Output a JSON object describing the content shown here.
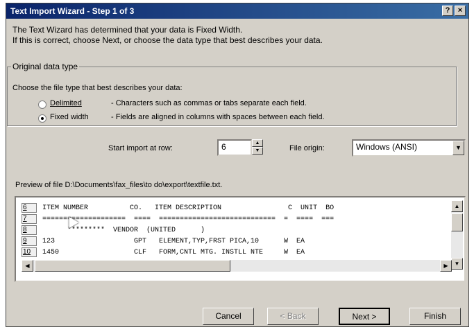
{
  "window": {
    "title": "Text Import Wizard - Step 1 of 3",
    "help_label": "?",
    "close_label": "×"
  },
  "intro": {
    "line1": "The Text Wizard has determined that your data is Fixed Width.",
    "line2": "If this is correct, choose Next, or choose the data type that best describes your data."
  },
  "data_type": {
    "group_label": "Original data type",
    "prompt": "Choose the file type that best describes your data:",
    "options": [
      {
        "label": "Delimited",
        "description": "- Characters such as commas or tabs separate each field.",
        "selected": false
      },
      {
        "label": "Fixed width",
        "description": "- Fields are aligned in columns with spaces between each field.",
        "selected": true
      }
    ]
  },
  "import": {
    "start_row_label": "Start import at row:",
    "start_row_value": "6",
    "origin_label": "File origin:",
    "origin_value": "Windows (ANSI)"
  },
  "preview": {
    "label": "Preview of file D:\\Documents\\fax_files\\to do\\export\\textfile.txt.",
    "rows": [
      {
        "num": "6",
        "text": "ITEM NUMBER          CO.   ITEM DESCRIPTION                C  UNIT  BO"
      },
      {
        "num": "7",
        "text": "====================  ====  ============================  =  ====  ==="
      },
      {
        "num": "8",
        "text": "      *********  VENDOR  (UNITED      )"
      },
      {
        "num": "9",
        "text": "123                   GPT   ELEMENT,TYP,FRST PICA,10      W  EA"
      },
      {
        "num": "10",
        "text": "1450                  CLF   FORM,CNTL MTG. INSTLL NTE     W  EA"
      }
    ]
  },
  "buttons": {
    "cancel": "Cancel",
    "back": "< Back",
    "next": "Next >",
    "finish": "Finish"
  },
  "icons": {
    "up": "▲",
    "down": "▼",
    "left": "◀",
    "right": "▶"
  },
  "colors": {
    "title_bar": "#0a246a",
    "dialog_face": "#d4d0c8"
  }
}
